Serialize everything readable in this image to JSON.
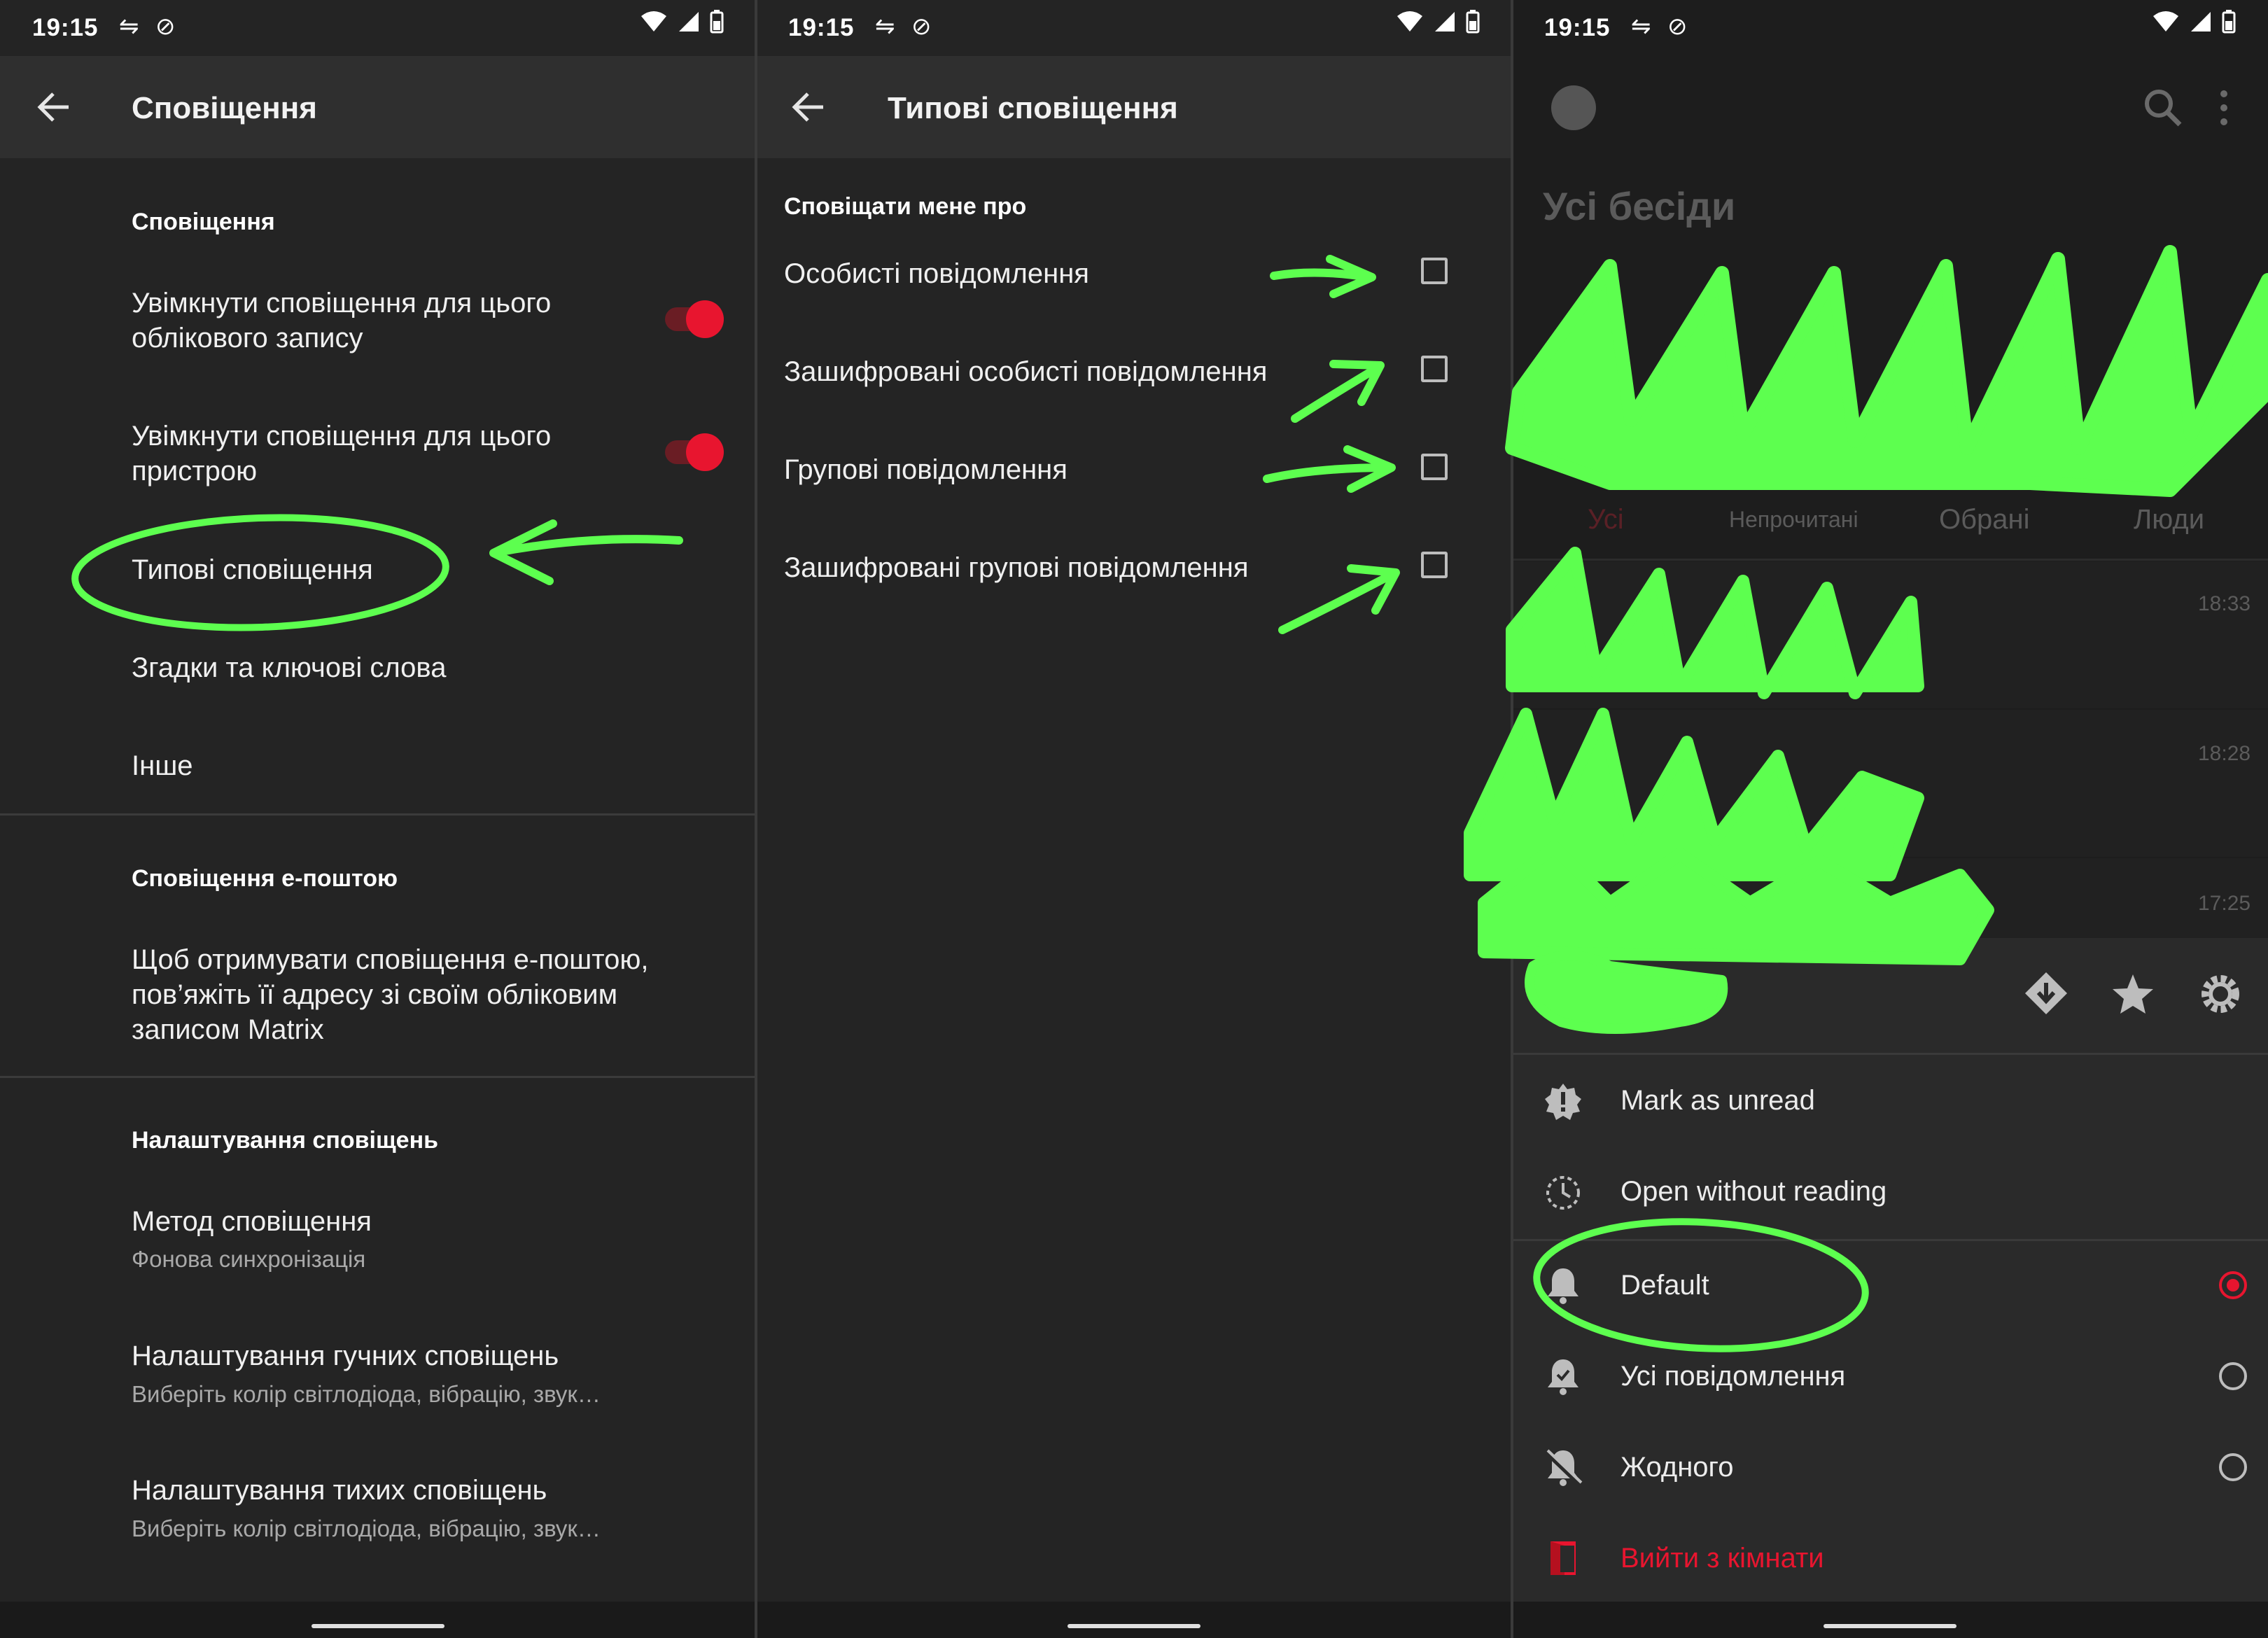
{
  "status_bar": {
    "time": "19:15"
  },
  "panel1": {
    "title": "Сповіщення",
    "section_notifications": "Сповіщення",
    "enable_account": "Увімкнути сповіщення для цього облікового запису",
    "enable_account_line1": "Увімкнути сповіщення для цього",
    "enable_account_line2": "облікового запису",
    "enable_device_line1": "Увімкнути сповіщення для цього",
    "enable_device_line2": "пристрою",
    "default_notifications": "Типові сповіщення",
    "mentions_keywords": "Згадки та ключові слова",
    "other": "Інше",
    "section_email": "Сповіщення е-поштою",
    "email_line1": "Щоб отримувати сповіщення е-поштою,",
    "email_line2": "пов’яжіть її адресу зі своїм обліковим",
    "email_line3": "записом Matrix",
    "section_settings": "Налаштування сповіщень",
    "method_title": "Метод сповіщення",
    "method_value": "Фонова синхронізація",
    "noisy_title": "Налаштування гучних сповіщень",
    "noisy_sub": "Виберіть колір світлодіода, вібрацію, звук…",
    "silent_title": "Налаштування тихих сповіщень",
    "silent_sub": "Виберіть колір світлодіода, вібрацію, звук…"
  },
  "panel2": {
    "title": "Типові сповіщення",
    "section": "Сповіщати мене про",
    "options": [
      "Особисті повідомлення",
      "Зашифровані особисті повідомлення",
      "Групові повідомлення",
      "Зашифровані групові повідомлення"
    ]
  },
  "panel3": {
    "title": "Усі бесіди",
    "tabs": [
      "Усі",
      "Непрочитані",
      "Обрані",
      "Люди"
    ],
    "times": [
      "18:33",
      "18:28",
      "17:25"
    ],
    "menu": {
      "mark_unread": "Mark as unread",
      "open_without_reading": "Open without reading",
      "default": "Default",
      "all_messages": "Усі повідомлення",
      "none": "Жодного",
      "leave_room": "Вийти з кімнати"
    }
  },
  "colors": {
    "accent": "#e8152f",
    "annotation": "#5dff4f"
  }
}
